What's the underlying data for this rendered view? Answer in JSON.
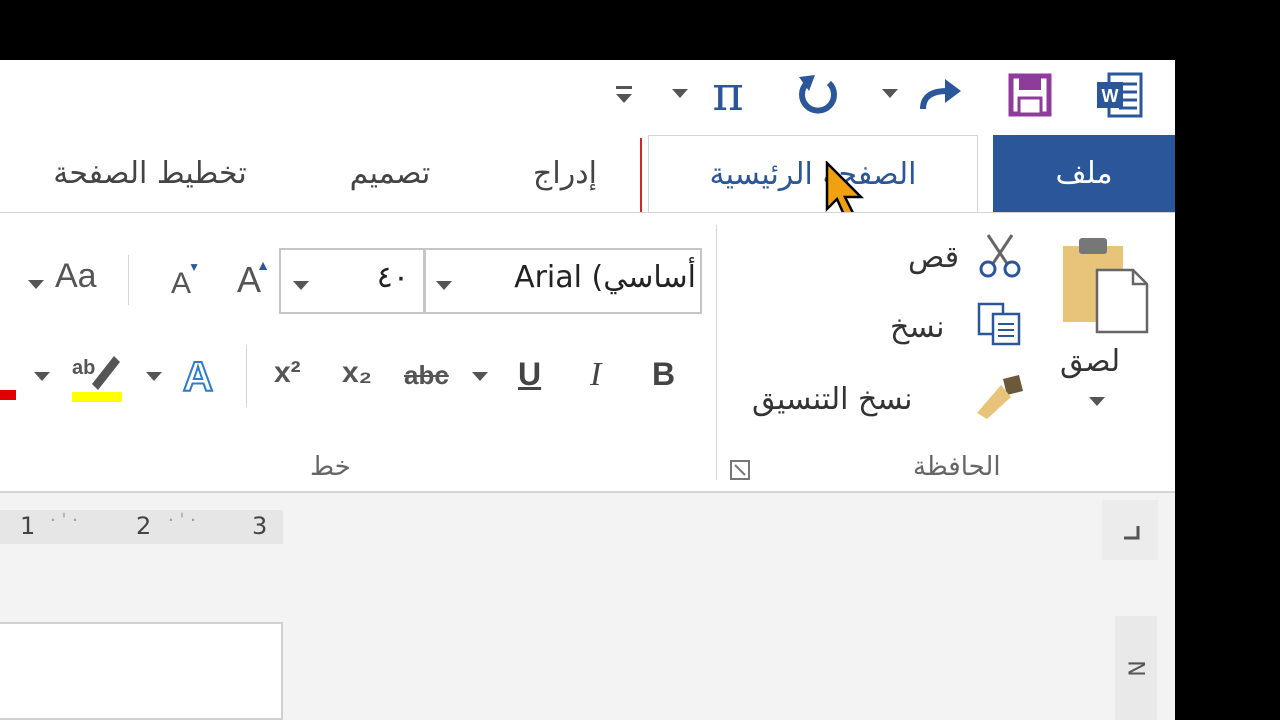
{
  "qat": {
    "word_icon": "word-logo-icon",
    "save_icon": "save-icon",
    "redo_icon": "redo-icon",
    "undo_icon": "undo-icon",
    "equation_icon": "pi-icon",
    "customize_icon": "customize-qat-icon"
  },
  "tabs": {
    "file": "ملف",
    "home": "الصفحة الرئيسية",
    "insert": "إدراج",
    "design": "تصميم",
    "layout": "تخطيط الصفحة"
  },
  "clipboard": {
    "paste": "لصق",
    "cut": "قص",
    "copy": "نسخ",
    "format_painter": "نسخ التنسيق",
    "group_label": "الحافظة"
  },
  "font": {
    "name": "Arial (أساسي",
    "size": "٤٠",
    "change_case": "Aa",
    "bold": "B",
    "italic": "I",
    "underline": "U",
    "strike": "abc",
    "subscript": "x₂",
    "superscript": "x²",
    "group_label": "خط"
  },
  "ruler": {
    "ticks": [
      "1",
      "2",
      "3"
    ]
  },
  "side": {
    "label": "N"
  },
  "colors": {
    "accent": "#2b579a",
    "highlight": "#ffff00",
    "font_red": "#e00000",
    "mark": "#d1252c"
  }
}
